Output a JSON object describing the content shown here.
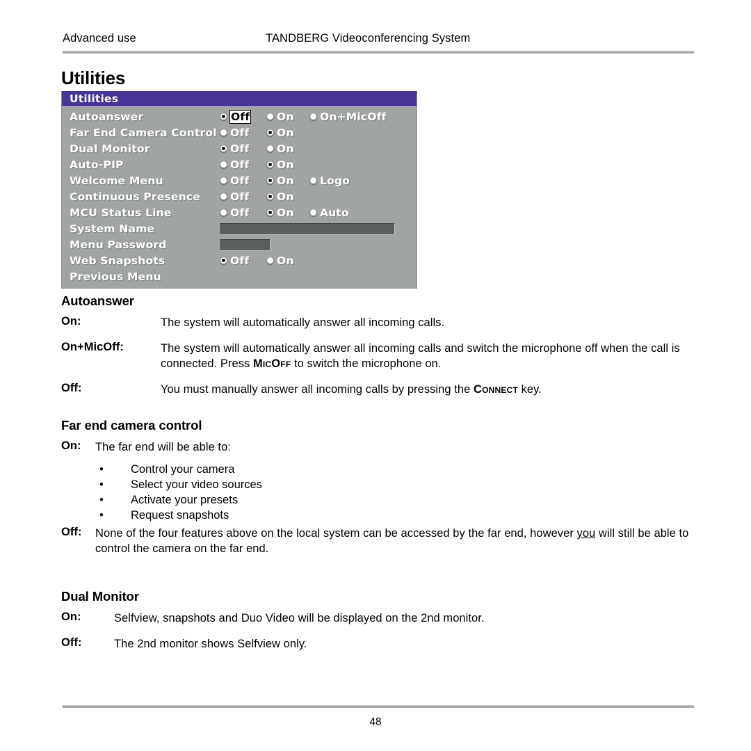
{
  "header": {
    "left": "Advanced use",
    "right": "TANDBERG Videoconferencing System"
  },
  "page_title": "Utilities",
  "osd": {
    "title": "Utilities",
    "rows": [
      {
        "label": "Autoanswer",
        "options": [
          {
            "text": "Off",
            "selected": true,
            "focused": true
          },
          {
            "text": "On",
            "selected": false,
            "focused": false
          },
          {
            "text": "On+MicOff",
            "selected": false,
            "focused": false
          }
        ]
      },
      {
        "label": "Far End Camera Control",
        "options": [
          {
            "text": "Off",
            "selected": false,
            "focused": false
          },
          {
            "text": "On",
            "selected": true,
            "focused": false
          }
        ]
      },
      {
        "label": "Dual Monitor",
        "options": [
          {
            "text": "Off",
            "selected": true,
            "focused": false
          },
          {
            "text": "On",
            "selected": false,
            "focused": false
          }
        ]
      },
      {
        "label": "Auto-PIP",
        "options": [
          {
            "text": "Off",
            "selected": false,
            "focused": false
          },
          {
            "text": "On",
            "selected": true,
            "focused": false
          }
        ]
      },
      {
        "label": "Welcome Menu",
        "options": [
          {
            "text": "Off",
            "selected": false,
            "focused": false
          },
          {
            "text": "On",
            "selected": true,
            "focused": false
          },
          {
            "text": "Logo",
            "selected": false,
            "focused": false
          }
        ]
      },
      {
        "label": "Continuous Presence",
        "options": [
          {
            "text": "Off",
            "selected": false,
            "focused": false
          },
          {
            "text": "On",
            "selected": true,
            "focused": false
          }
        ]
      },
      {
        "label": "MCU Status Line",
        "options": [
          {
            "text": "Off",
            "selected": false,
            "focused": false
          },
          {
            "text": "On",
            "selected": true,
            "focused": false
          },
          {
            "text": "Auto",
            "selected": false,
            "focused": false
          }
        ]
      },
      {
        "label": "System Name",
        "field": {
          "value": ""
        }
      },
      {
        "label": "Menu Password",
        "field": {
          "value": ""
        }
      },
      {
        "label": "Web Snapshots",
        "options": [
          {
            "text": "Off",
            "selected": true,
            "focused": false
          },
          {
            "text": "On",
            "selected": false,
            "focused": false
          }
        ]
      },
      {
        "label": "Previous Menu"
      }
    ],
    "colors": {
      "titlebar": "#473494",
      "background": "#a0a4a3",
      "field": "#5a5e5c",
      "label_text": "#ffffff"
    }
  },
  "sections": {
    "autoanswer": {
      "heading": "Autoanswer",
      "items": [
        {
          "term": "On:",
          "text": "The system will automatically answer all incoming calls."
        },
        {
          "term": "On+MicOff:",
          "line1_a": "The system will automatically answer all incoming calls and switch the microphone off when",
          "line2_a": "the call is connected. Press ",
          "line2_key": "MicOff",
          "line2_b": " to switch the microphone on."
        },
        {
          "term": "Off:",
          "line_a": "You must manually answer all incoming calls by pressing the ",
          "line_key": "Connect",
          "line_b": " key."
        }
      ]
    },
    "far_end_camera_control": {
      "heading": "Far end camera control",
      "on_term": "On:",
      "on_text": "The far end will be able to:",
      "bullets": [
        "Control your camera",
        "Select your video sources",
        "Activate your presets",
        "Request snapshots"
      ],
      "off_term": "Off:",
      "off_line1_a": "None of the four features above on the local system can be accessed by the far end, however ",
      "off_line1_u": "you",
      "off_line1_b": " will still",
      "off_line2": "be able to control the camera on the far end."
    },
    "dual_monitor": {
      "heading": "Dual Monitor",
      "items": [
        {
          "term": "On:",
          "text": "Selfview, snapshots and Duo Video will be displayed on the 2nd monitor."
        },
        {
          "term": "Off:",
          "text": "The 2nd monitor  shows Selfview only."
        }
      ]
    }
  },
  "footer": {
    "page_number": "48"
  }
}
